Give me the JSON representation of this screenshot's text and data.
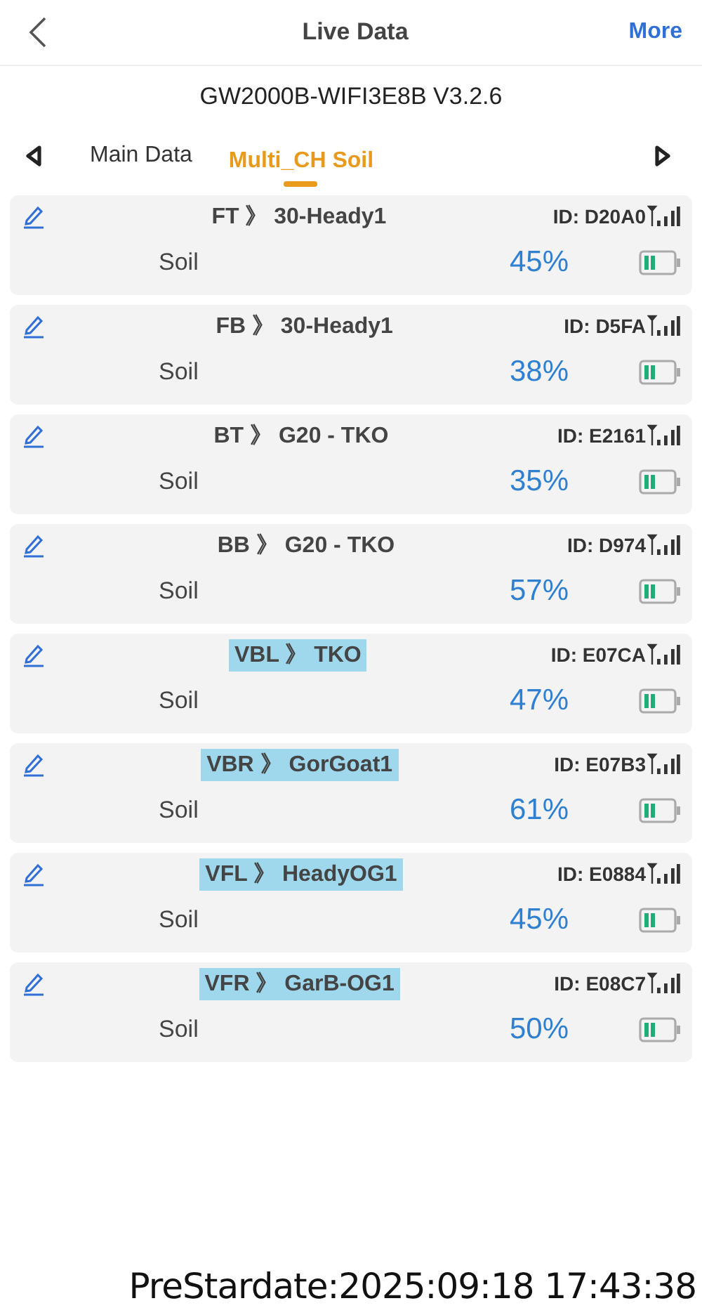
{
  "header": {
    "title": "Live Data",
    "action": "More"
  },
  "device": "GW2000B-WIFI3E8B V3.2.6",
  "tabs": [
    {
      "label": "Main Data",
      "selected": false
    },
    {
      "label": "Multi_CH Soil",
      "selected": true
    }
  ],
  "sensors": [
    {
      "name": "FT 》 30-Heady1",
      "highlighted": false,
      "id": "ID: D20A0",
      "label": "Soil",
      "value": "45%"
    },
    {
      "name": "FB 》 30-Heady1",
      "highlighted": false,
      "id": "ID: D5FA",
      "label": "Soil",
      "value": "38%"
    },
    {
      "name": "BT 》 G20 - TKO",
      "highlighted": false,
      "id": "ID: E2161",
      "label": "Soil",
      "value": "35%"
    },
    {
      "name": "BB 》 G20 - TKO",
      "highlighted": false,
      "id": "ID: D974",
      "label": "Soil",
      "value": "57%"
    },
    {
      "name": "VBL 》 TKO",
      "highlighted": true,
      "id": "ID: E07CA",
      "label": "Soil",
      "value": "47%"
    },
    {
      "name": "VBR 》 GorGoat1",
      "highlighted": true,
      "id": "ID: E07B3",
      "label": "Soil",
      "value": "61%"
    },
    {
      "name": "VFL 》 HeadyOG1",
      "highlighted": true,
      "id": "ID: E0884",
      "label": "Soil",
      "value": "45%"
    },
    {
      "name": "VFR 》 GarB-OG1",
      "highlighted": true,
      "id": "ID: E08C7",
      "label": "Soil",
      "value": "50%"
    }
  ],
  "stamp": "PreStardate:2025:09:18 17:43:38"
}
